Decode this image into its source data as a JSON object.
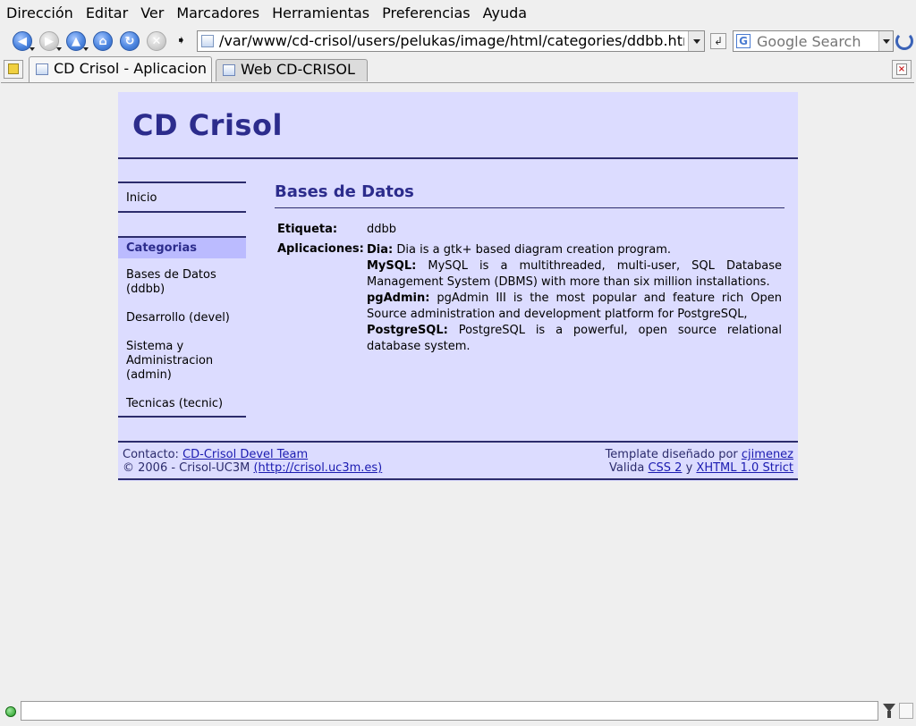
{
  "browser": {
    "menu": [
      "Dirección",
      "Editar",
      "Ver",
      "Marcadores",
      "Herramientas",
      "Preferencias",
      "Ayuda"
    ],
    "url": "/var/www/cd-crisol/users/pelukas/image/html/categories/ddbb.html",
    "search_placeholder": "Google Search",
    "search_engine_letter": "G",
    "tabs": [
      {
        "label": "CD Crisol - Aplicacion"
      },
      {
        "label": "Web CD-CRISOL"
      }
    ],
    "nav_glyphs": {
      "back": "◀",
      "forward": "▶",
      "up": "▲",
      "home": "⌂",
      "reload": "↻",
      "stop": "✕",
      "go": "↲"
    }
  },
  "page": {
    "site_title": "CD Crisol",
    "sidebar": {
      "home": "Inicio",
      "categories_header": "Categorias",
      "categories": [
        "Bases de Datos (ddbb)",
        "Desarrollo (devel)",
        "Sistema y Administracion (admin)",
        "Tecnicas (tecnic)"
      ]
    },
    "content": {
      "title": "Bases de Datos",
      "etiqueta_label": "Etiqueta:",
      "etiqueta_value": "ddbb",
      "aplicaciones_label": "Aplicaciones:",
      "apps": [
        {
          "name": "Dia:",
          "desc": "Dia is a gtk+ based diagram creation program."
        },
        {
          "name": "MySQL:",
          "desc": "MySQL is a multithreaded, multi-user, SQL Database Management System (DBMS) with more than six million installations."
        },
        {
          "name": "pgAdmin:",
          "desc": "pgAdmin III is the most popular and feature rich Open Source administration and development platform for PostgreSQL,"
        },
        {
          "name": "PostgreSQL:",
          "desc": "PostgreSQL is a powerful, open source relational database system."
        }
      ]
    },
    "footer": {
      "contact_label": "Contacto:",
      "contact_link": "CD-Crisol Devel Team",
      "copyright": "© 2006 - Crisol-UC3M",
      "copyright_link": "(http://crisol.uc3m.es)",
      "template_label": "Template diseñado por",
      "template_link": "cjimenez",
      "valida_label": "Valida",
      "css_link": "CSS 2",
      "y": "y",
      "xhtml_link": "XHTML 1.0 Strict"
    }
  },
  "colors": {
    "page_bg": "#dcdcff",
    "title_blue": "#2c2c8c",
    "rule": "#2c2c6c",
    "link": "#1b1bb0"
  }
}
